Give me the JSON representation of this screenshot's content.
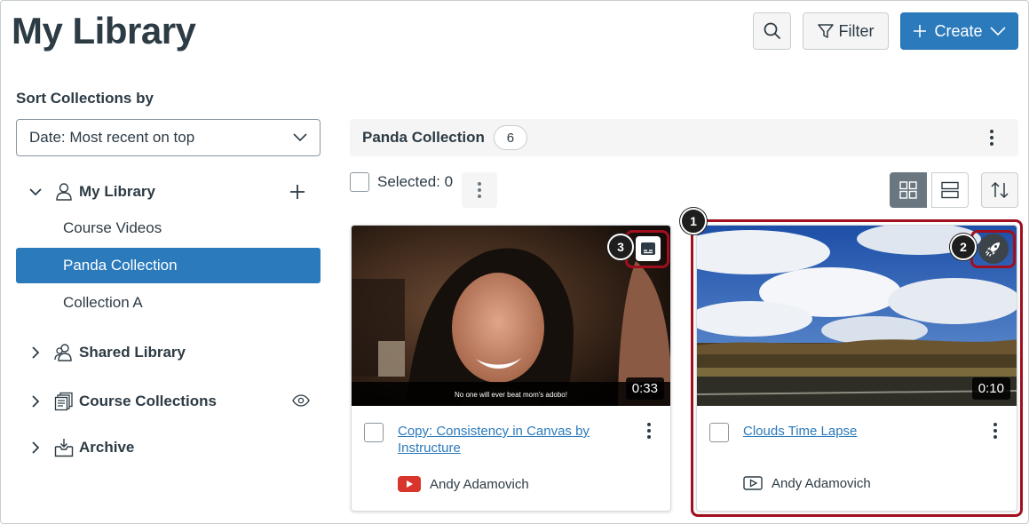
{
  "header": {
    "title": "My Library",
    "filter_label": "Filter",
    "create_label": "Create"
  },
  "sidebar": {
    "sort_label": "Sort Collections by",
    "sort_value": "Date: Most recent on top",
    "my_library": "My Library",
    "items": [
      "Course Videos",
      "Panda Collection",
      "Collection A"
    ],
    "shared_library": "Shared Library",
    "course_collections": "Course Collections",
    "archive": "Archive"
  },
  "collection": {
    "name": "Panda Collection",
    "count": "6",
    "selected_label": "Selected: 0"
  },
  "cards": [
    {
      "title": "Copy: Consistency in Canvas by Instructure",
      "duration": "0:33",
      "owner": "Andy Adamovich",
      "caption": "No one will ever beat mom's adobo!",
      "source_icon": "youtube-icon"
    },
    {
      "title": "Clouds Time Lapse",
      "duration": "0:10",
      "owner": "Andy Adamovich",
      "source_icon": "video-icon"
    }
  ],
  "callouts": [
    "1",
    "2",
    "3"
  ],
  "colors": {
    "accent": "#2b7abc",
    "highlight": "#a10f1f",
    "text": "#2d3b45"
  }
}
